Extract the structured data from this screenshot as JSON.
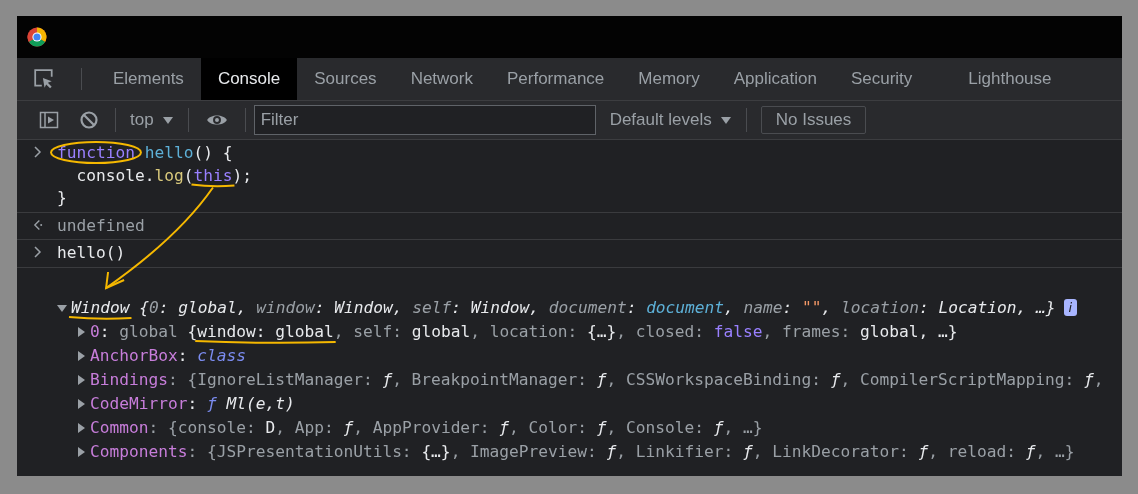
{
  "tabs": [
    {
      "label": "Elements",
      "selected": false
    },
    {
      "label": "Console",
      "selected": true
    },
    {
      "label": "Sources",
      "selected": false
    },
    {
      "label": "Network",
      "selected": false
    },
    {
      "label": "Performance",
      "selected": false
    },
    {
      "label": "Memory",
      "selected": false
    },
    {
      "label": "Application",
      "selected": false
    },
    {
      "label": "Security",
      "selected": false
    },
    {
      "label": "Lighthouse",
      "selected": false
    }
  ],
  "toolbar": {
    "context": "top",
    "filter": {
      "placeholder": "Filter"
    },
    "levels": "Default levels",
    "issues": "No Issues"
  },
  "console": [
    {
      "kind": "input",
      "lines": [
        [
          {
            "text": "function",
            "kind": "keyword",
            "circled": true
          },
          {
            "text": " hello",
            "kind": "fname"
          },
          {
            "text": "() {",
            "kind": "plain"
          }
        ],
        [
          {
            "text": "  console.",
            "kind": "plain"
          },
          {
            "text": "log",
            "kind": "method"
          },
          {
            "text": "(",
            "kind": "plain"
          },
          {
            "text": "this",
            "kind": "keyword",
            "underlined": true,
            "arrow_start": true
          },
          {
            "text": ");",
            "kind": "plain"
          }
        ],
        [
          {
            "text": "}",
            "kind": "plain"
          }
        ]
      ]
    },
    {
      "kind": "result",
      "lines": [
        [
          {
            "text": "undefined",
            "kind": "dim"
          }
        ]
      ]
    },
    {
      "kind": "input",
      "lines": [
        [
          {
            "text": "hello()",
            "kind": "plain"
          }
        ]
      ]
    },
    {
      "kind": "object",
      "expanded": true,
      "info": "i",
      "summary": [
        {
          "text": "Window",
          "kind": "ivalue",
          "underlined": true,
          "arrow_end": true
        },
        {
          "text": " {",
          "kind": "ivalue"
        },
        {
          "text": "0",
          "kind": "ikey"
        },
        {
          "text": ": ",
          "kind": "ivalue"
        },
        {
          "text": "global",
          "kind": "ivalue"
        },
        {
          "text": ", ",
          "kind": "ivalue"
        },
        {
          "text": "window",
          "kind": "ikey"
        },
        {
          "text": ": ",
          "kind": "ivalue"
        },
        {
          "text": "Window",
          "kind": "ivalue"
        },
        {
          "text": ", ",
          "kind": "ivalue"
        },
        {
          "text": "self",
          "kind": "ikey"
        },
        {
          "text": ": ",
          "kind": "ivalue"
        },
        {
          "text": "Window",
          "kind": "ivalue"
        },
        {
          "text": ", ",
          "kind": "ivalue"
        },
        {
          "text": "document",
          "kind": "ikey"
        },
        {
          "text": ": ",
          "kind": "ivalue"
        },
        {
          "text": "document",
          "kind": "inode"
        },
        {
          "text": ", ",
          "kind": "ivalue"
        },
        {
          "text": "name",
          "kind": "ikey"
        },
        {
          "text": ": ",
          "kind": "ivalue"
        },
        {
          "text": "\"\"",
          "kind": "string"
        },
        {
          "text": ", ",
          "kind": "ivalue"
        },
        {
          "text": "location",
          "kind": "ikey"
        },
        {
          "text": ": ",
          "kind": "ivalue"
        },
        {
          "text": "Location",
          "kind": "ivalue"
        },
        {
          "text": ", …}",
          "kind": "ivalue"
        }
      ],
      "children": [
        {
          "expanded": false,
          "tokens": [
            {
              "text": "0",
              "kind": "prop"
            },
            {
              "text": ": ",
              "kind": "plain"
            },
            {
              "text": "global ",
              "kind": "dim"
            },
            {
              "text": "{",
              "kind": "plain"
            },
            {
              "text": "window: global",
              "kind": "plain",
              "underlined": true
            },
            {
              "text": ", self: ",
              "kind": "dim"
            },
            {
              "text": "global",
              "kind": "plain"
            },
            {
              "text": ", location: ",
              "kind": "dim"
            },
            {
              "text": "{…}",
              "kind": "plain"
            },
            {
              "text": ", closed: ",
              "kind": "dim"
            },
            {
              "text": "false",
              "kind": "keyword"
            },
            {
              "text": ", frames: ",
              "kind": "dim"
            },
            {
              "text": "global",
              "kind": "plain"
            },
            {
              "text": ", …}",
              "kind": "plain"
            }
          ]
        },
        {
          "expanded": false,
          "tokens": [
            {
              "text": "AnchorBox",
              "kind": "prop"
            },
            {
              "text": ": ",
              "kind": "plain"
            },
            {
              "text": "class",
              "kind": "iclass"
            }
          ]
        },
        {
          "expanded": false,
          "tokens": [
            {
              "text": "Bindings",
              "kind": "prop"
            },
            {
              "text": ": {IgnoreListManager: ",
              "kind": "dim"
            },
            {
              "text": "ƒ",
              "kind": "ivalue"
            },
            {
              "text": ", BreakpointManager: ",
              "kind": "dim"
            },
            {
              "text": "ƒ",
              "kind": "ivalue"
            },
            {
              "text": ", CSSWorkspaceBinding: ",
              "kind": "dim"
            },
            {
              "text": "ƒ",
              "kind": "ivalue"
            },
            {
              "text": ", CompilerScriptMapping: ",
              "kind": "dim"
            },
            {
              "text": "ƒ",
              "kind": "ivalue"
            },
            {
              "text": ",",
              "kind": "dim"
            }
          ]
        },
        {
          "expanded": false,
          "tokens": [
            {
              "text": "CodeMirror",
              "kind": "prop"
            },
            {
              "text": ": ",
              "kind": "plain"
            },
            {
              "text": "ƒ ",
              "kind": "iclass"
            },
            {
              "text": "Ml(e,t)",
              "kind": "ivalue"
            }
          ]
        },
        {
          "expanded": false,
          "tokens": [
            {
              "text": "Common",
              "kind": "prop"
            },
            {
              "text": ": {console: ",
              "kind": "dim"
            },
            {
              "text": "D",
              "kind": "plain"
            },
            {
              "text": ", App: ",
              "kind": "dim"
            },
            {
              "text": "ƒ",
              "kind": "ivalue"
            },
            {
              "text": ", AppProvider: ",
              "kind": "dim"
            },
            {
              "text": "ƒ",
              "kind": "ivalue"
            },
            {
              "text": ", Color: ",
              "kind": "dim"
            },
            {
              "text": "ƒ",
              "kind": "ivalue"
            },
            {
              "text": ", Console: ",
              "kind": "dim"
            },
            {
              "text": "ƒ",
              "kind": "ivalue"
            },
            {
              "text": ", …}",
              "kind": "dim"
            }
          ]
        },
        {
          "expanded": false,
          "tokens": [
            {
              "text": "Components",
              "kind": "prop"
            },
            {
              "text": ": {JSPresentationUtils: ",
              "kind": "dim"
            },
            {
              "text": "{…}",
              "kind": "plain"
            },
            {
              "text": ", ImagePreview: ",
              "kind": "dim"
            },
            {
              "text": "ƒ",
              "kind": "ivalue"
            },
            {
              "text": ", Linkifier: ",
              "kind": "dim"
            },
            {
              "text": "ƒ",
              "kind": "ivalue"
            },
            {
              "text": ", LinkDecorator: ",
              "kind": "dim"
            },
            {
              "text": "ƒ",
              "kind": "ivalue"
            },
            {
              "text": ", reload: ",
              "kind": "dim"
            },
            {
              "text": "ƒ",
              "kind": "ivalue"
            },
            {
              "text": ", …}",
              "kind": "dim"
            }
          ]
        }
      ]
    }
  ]
}
